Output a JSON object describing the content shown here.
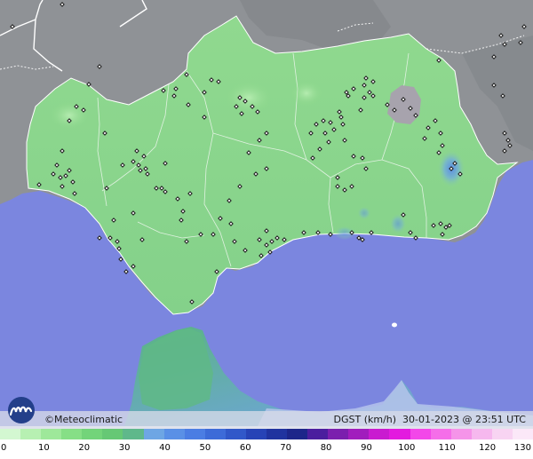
{
  "map": {
    "brand": "Meteoclimatic",
    "copyright_symbol": "©",
    "variable": "DGST",
    "unit": "(km/h)",
    "date": "30-01-2023",
    "at_symbol": "@",
    "time": "23:51 UTC",
    "colors": {
      "sea": "#7b86df",
      "land_outside": "#8f9296",
      "land_green": "#8ed88c",
      "land_green_dark": "#6fc47a",
      "border_white": "#ffffff",
      "station_marker": "#1e1e1e"
    },
    "logo_icon": "meteoclimatic-logo-icon"
  },
  "scale": {
    "ticks": [
      "0",
      "10",
      "20",
      "30",
      "40",
      "50",
      "60",
      "70",
      "80",
      "90",
      "100",
      "110",
      "120",
      "130"
    ],
    "colors": [
      "#d3f7d1",
      "#b7f0b2",
      "#9ee89a",
      "#86df86",
      "#73d47a",
      "#66c875",
      "#5fb88b",
      "#6ea6e4",
      "#5a90e6",
      "#4b7de3",
      "#3d6bd8",
      "#3158c9",
      "#2743b6",
      "#20339f",
      "#1d268a",
      "#4b1e9e",
      "#7b1fae",
      "#a11dbd",
      "#c91bd0",
      "#e31adf",
      "#f347e9",
      "#f56ee9",
      "#f594e9",
      "#f6b8ee",
      "#f8d4f2",
      "#fbe8f8"
    ]
  }
}
